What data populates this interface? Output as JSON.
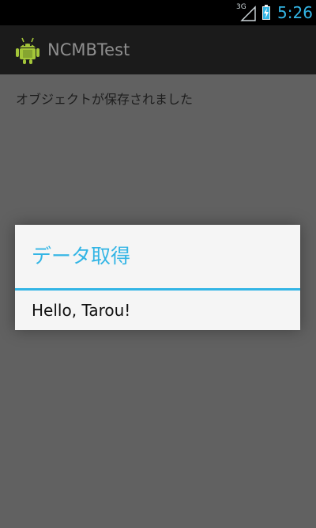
{
  "status_bar": {
    "network_type": "3G",
    "time": "5:26",
    "accent_color": "#33b5e5"
  },
  "action_bar": {
    "app_title": "NCMBTest",
    "app_icon": "android-robot-icon"
  },
  "content": {
    "message": "オブジェクトが保存されました"
  },
  "dialog": {
    "title": "データ取得",
    "message": "Hello, Tarou!"
  },
  "colors": {
    "background": "#616161",
    "dialog_background": "#f5f5f5",
    "accent": "#33b5e5"
  }
}
